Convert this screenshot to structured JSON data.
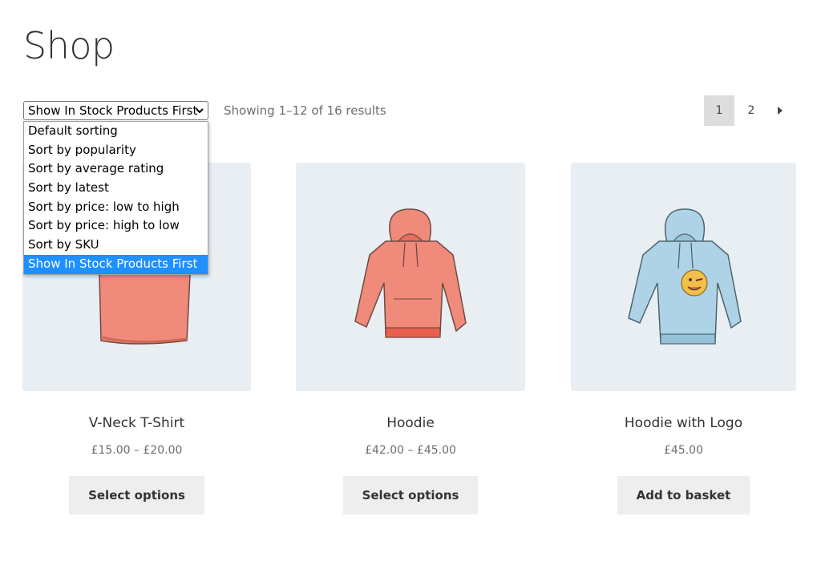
{
  "page": {
    "title": "Shop"
  },
  "toolbar": {
    "sort_selected": "Show In Stock Products First",
    "result_count": "Showing 1–12 of 16 results",
    "sort_options": [
      "Default sorting",
      "Sort by popularity",
      "Sort by average rating",
      "Sort by latest",
      "Sort by price: low to high",
      "Sort by price: high to low",
      "Sort by SKU",
      "Show In Stock Products First"
    ],
    "pagination": {
      "pages": [
        "1",
        "2"
      ],
      "current": "1",
      "next_icon": "triangle-right-icon"
    }
  },
  "products": [
    {
      "name": "V-Neck T-Shirt",
      "price": "£15.00 – £20.00",
      "button": "Select options",
      "image": "t-shirt-image"
    },
    {
      "name": "Hoodie",
      "price": "£42.00 – £45.00",
      "button": "Select options",
      "image": "hoodie-image"
    },
    {
      "name": "Hoodie with Logo",
      "price": "£45.00",
      "button": "Add to basket",
      "image": "hoodie-with-logo-image"
    }
  ],
  "colors": {
    "selected_option": "#1e90ff",
    "image_background": "#e9eef3",
    "coral": "#f08a7a",
    "light_blue": "#aed3e6"
  }
}
